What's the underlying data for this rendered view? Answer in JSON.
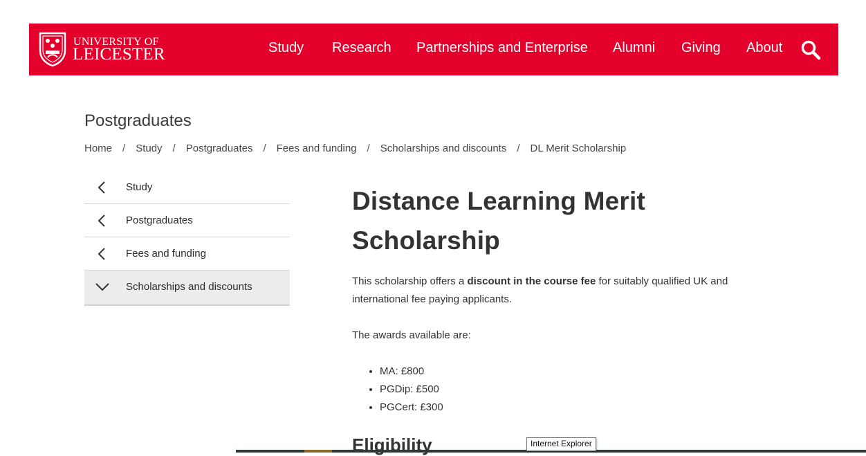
{
  "header": {
    "logo": {
      "line1": "UNIVERSITY OF",
      "line2": "LEICESTER"
    },
    "nav": [
      {
        "label": "Study"
      },
      {
        "label": "Research"
      },
      {
        "label": "Partnerships and Enterprise"
      },
      {
        "label": "Alumni"
      },
      {
        "label": "Giving"
      },
      {
        "label": "About"
      }
    ],
    "search_icon": "search-icon",
    "brand_color": "#e4002b"
  },
  "section_title": "Postgraduates",
  "breadcrumb": {
    "separator": "/",
    "items": [
      "Home",
      "Study",
      "Postgraduates",
      "Fees and funding",
      "Scholarships and discounts",
      "DL Merit Scholarship"
    ]
  },
  "sidenav": {
    "items": [
      {
        "label": "Study",
        "icon": "chevron-left-icon"
      },
      {
        "label": "Postgraduates",
        "icon": "chevron-left-icon"
      },
      {
        "label": "Fees and funding",
        "icon": "chevron-left-icon"
      },
      {
        "label": "Scholarships and discounts",
        "icon": "chevron-down-icon"
      }
    ]
  },
  "main": {
    "title_line1": "Distance Learning Merit",
    "title_line2": "Scholarship",
    "intro": {
      "before": "This scholarship offers a ",
      "bold": "discount in the course fee",
      "after": " for suitably qualified UK and international fee paying applicants."
    },
    "awards_intro": "The awards available are:",
    "awards": [
      "MA: £800",
      "PGDip: £500",
      "PGCert: £300"
    ],
    "next_heading": "Eligibility"
  },
  "tooltip": "Internet Explorer"
}
